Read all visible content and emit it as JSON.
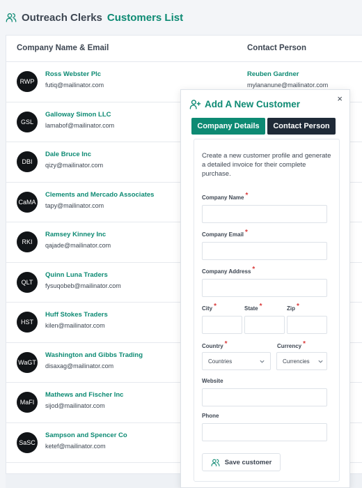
{
  "header": {
    "org_name": "Outreach Clerks",
    "page_title": "Customers List"
  },
  "table": {
    "columns": [
      "Company Name & Email",
      "Contact Person"
    ],
    "rows": [
      {
        "initials": "RWP",
        "company": "Ross Webster Plc",
        "email": "futiq@mailinator.com",
        "contact": "Reuben Gardner",
        "contact_email": "mylananune@mailinator.com"
      },
      {
        "initials": "GSL",
        "company": "Galloway Simon LLC",
        "email": "lamabof@mailinator.com"
      },
      {
        "initials": "DBI",
        "company": "Dale Bruce Inc",
        "email": "qizy@mailinator.com"
      },
      {
        "initials": "CaMA",
        "company": "Clements and Mercado Associates",
        "email": "tapy@mailinator.com"
      },
      {
        "initials": "RKI",
        "company": "Ramsey Kinney Inc",
        "email": "qajade@mailinator.com"
      },
      {
        "initials": "QLT",
        "company": "Quinn Luna Traders",
        "email": "fysuqobeb@mailinator.com"
      },
      {
        "initials": "HST",
        "company": "Huff Stokes Traders",
        "email": "kilen@mailinator.com"
      },
      {
        "initials": "WaGT",
        "company": "Washington and Gibbs Trading",
        "email": "disaxag@mailinator.com"
      },
      {
        "initials": "MaFI",
        "company": "Mathews and Fischer Inc",
        "email": "sijod@mailinator.com"
      },
      {
        "initials": "SaSC",
        "company": "Sampson and Spencer Co",
        "email": "ketef@mailinator.com"
      }
    ]
  },
  "modal": {
    "close_symbol": "×",
    "title": "Add A New Customer",
    "tabs": [
      "Company Details",
      "Contact Person"
    ],
    "description": "Create a new customer profile and generate a detailed invoice for their complete purchase.",
    "required_marker": "*",
    "fields": {
      "company_name": "Company Name",
      "company_email": "Company Email",
      "company_address": "Company Address",
      "city": "City",
      "state": "State",
      "zip": "Zip",
      "country": "Country",
      "currency": "Currency",
      "website": "Website",
      "phone": "Phone"
    },
    "selects": {
      "country_value": "Countries",
      "currency_value": "Currencies"
    },
    "save_label": "Save customer"
  },
  "colors": {
    "accent": "#0d8a73",
    "dark": "#1f2a37",
    "required": "#d93a3a"
  }
}
